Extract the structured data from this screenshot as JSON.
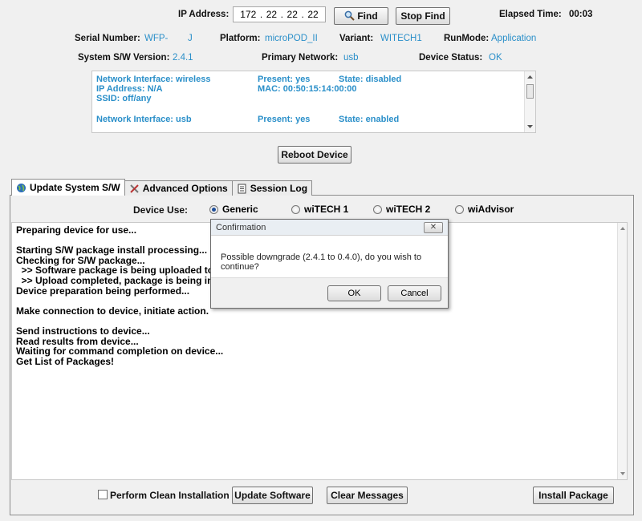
{
  "header": {
    "ip_label": "IP Address:",
    "ip_octets": [
      "172",
      "22",
      "22",
      "22"
    ],
    "find_label": "Find",
    "stop_find_label": "Stop Find",
    "elapsed_label": "Elapsed Time:",
    "elapsed_value": "00:03"
  },
  "device": {
    "serial_label": "Serial Number:",
    "serial_value": "WFP-",
    "serial_suffix": "J",
    "platform_label": "Platform:",
    "platform_value": "microPOD_II",
    "variant_label": "Variant:",
    "variant_value": "WITECH1",
    "runmode_label": "RunMode:",
    "runmode_value": "Application",
    "sw_version_label": "System S/W Version:",
    "sw_version_value": "2.4.1",
    "primary_network_label": "Primary Network:",
    "primary_network_value": "usb",
    "status_label": "Device Status:",
    "status_value": "OK"
  },
  "interfaces": [
    {
      "iface": "Network Interface: wireless",
      "present": "Present: yes",
      "state": "State: disabled",
      "ip": "IP Address: N/A",
      "mac": "MAC: 00:50:15:14:00:00",
      "ssid": "SSID: off/any"
    },
    {
      "iface": "Network Interface: usb",
      "present": "Present: yes",
      "state": "State: enabled"
    }
  ],
  "reboot_label": "Reboot Device",
  "tabs": [
    {
      "label": "Update System S/W"
    },
    {
      "label": "Advanced Options"
    },
    {
      "label": "Session Log"
    }
  ],
  "device_use": {
    "label": "Device Use:",
    "options": [
      "Generic",
      "wiTECH 1",
      "wiTECH 2",
      "wiAdvisor"
    ],
    "selected": "Generic"
  },
  "log_lines": [
    "Preparing device for use...",
    "",
    "Starting S/W package install processing...",
    "Checking for S/W package...",
    "  >> Software package is being uploaded to devi",
    "  >> Upload completed, package is being installe",
    "Device preparation being performed...",
    "",
    "Make connection to device, initiate action.",
    "",
    "Send instructions to device...",
    "Read results from device...",
    "Waiting for command completion on device...",
    "Get List of Packages!"
  ],
  "dialog": {
    "title": "Confirmation",
    "close": "✕",
    "message": "Possible downgrade (2.4.1 to 0.4.0), do you wish to continue?",
    "ok_label": "OK",
    "cancel_label": "Cancel"
  },
  "footer": {
    "clean_install_label": "Perform Clean Installation",
    "clean_install_checked": false,
    "update_label": "Update Software",
    "clear_label": "Clear Messages",
    "install_label": "Install Package"
  },
  "icons": [
    "search-icon",
    "globe-icon",
    "tools-icon",
    "log-icon",
    "scroll-up-icon",
    "scroll-down-icon"
  ],
  "colors": {
    "value_blue": "#2a8fc9"
  }
}
